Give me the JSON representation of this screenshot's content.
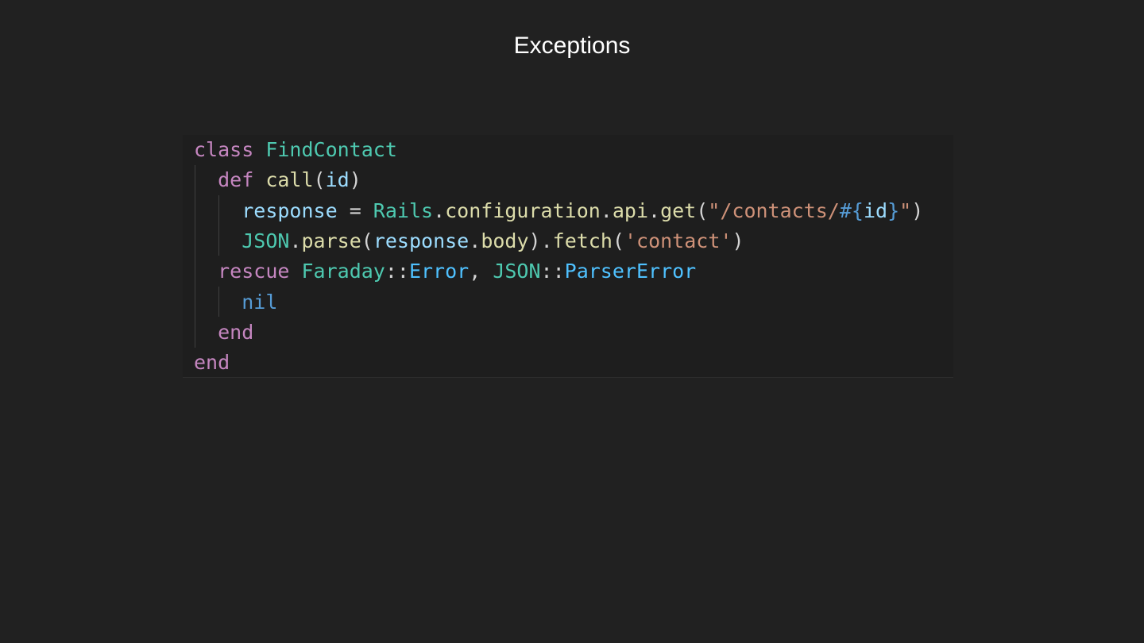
{
  "slide": {
    "title": "Exceptions"
  },
  "code": {
    "language": "ruby",
    "lines": [
      [
        {
          "text": "class",
          "role": "keyword"
        },
        {
          "text": " ",
          "role": "plain"
        },
        {
          "text": "FindContact",
          "role": "class"
        }
      ],
      [
        {
          "text": "  ",
          "role": "plain"
        },
        {
          "text": "def",
          "role": "keyword"
        },
        {
          "text": " ",
          "role": "plain"
        },
        {
          "text": "call",
          "role": "function"
        },
        {
          "text": "(",
          "role": "plain"
        },
        {
          "text": "id",
          "role": "variable"
        },
        {
          "text": ")",
          "role": "plain"
        }
      ],
      [
        {
          "text": "    ",
          "role": "plain"
        },
        {
          "text": "response",
          "role": "variable"
        },
        {
          "text": " = ",
          "role": "plain"
        },
        {
          "text": "Rails",
          "role": "class"
        },
        {
          "text": ".",
          "role": "plain"
        },
        {
          "text": "configuration",
          "role": "function"
        },
        {
          "text": ".",
          "role": "plain"
        },
        {
          "text": "api",
          "role": "function"
        },
        {
          "text": ".",
          "role": "plain"
        },
        {
          "text": "get",
          "role": "function"
        },
        {
          "text": "(",
          "role": "plain"
        },
        {
          "text": "\"/contacts/",
          "role": "string"
        },
        {
          "text": "#{",
          "role": "constant"
        },
        {
          "text": "id",
          "role": "variable"
        },
        {
          "text": "}",
          "role": "constant"
        },
        {
          "text": "\"",
          "role": "string"
        },
        {
          "text": ")",
          "role": "plain"
        }
      ],
      [
        {
          "text": "    ",
          "role": "plain"
        },
        {
          "text": "JSON",
          "role": "class"
        },
        {
          "text": ".",
          "role": "plain"
        },
        {
          "text": "parse",
          "role": "function"
        },
        {
          "text": "(",
          "role": "plain"
        },
        {
          "text": "response",
          "role": "variable"
        },
        {
          "text": ".",
          "role": "plain"
        },
        {
          "text": "body",
          "role": "function"
        },
        {
          "text": ").",
          "role": "plain"
        },
        {
          "text": "fetch",
          "role": "function"
        },
        {
          "text": "(",
          "role": "plain"
        },
        {
          "text": "'contact'",
          "role": "string"
        },
        {
          "text": ")",
          "role": "plain"
        }
      ],
      [
        {
          "text": "  ",
          "role": "plain"
        },
        {
          "text": "rescue",
          "role": "keyword"
        },
        {
          "text": " ",
          "role": "plain"
        },
        {
          "text": "Faraday",
          "role": "class"
        },
        {
          "text": "::",
          "role": "plain"
        },
        {
          "text": "Error",
          "role": "constant2"
        },
        {
          "text": ", ",
          "role": "plain"
        },
        {
          "text": "JSON",
          "role": "class"
        },
        {
          "text": "::",
          "role": "plain"
        },
        {
          "text": "ParserError",
          "role": "constant2"
        }
      ],
      [
        {
          "text": "    ",
          "role": "plain"
        },
        {
          "text": "nil",
          "role": "constant"
        }
      ],
      [
        {
          "text": "  ",
          "role": "plain"
        },
        {
          "text": "end",
          "role": "keyword"
        }
      ],
      [
        {
          "text": "end",
          "role": "keyword"
        }
      ]
    ]
  },
  "colors": {
    "background": "#212121",
    "code_background": "#1e1e1e",
    "keyword": "#c586c0",
    "class": "#4ec9b0",
    "function": "#dcdcaa",
    "variable": "#9cdcfe",
    "string": "#ce9178",
    "constant": "#569cd6",
    "constant2": "#4fc1ff",
    "plain": "#d4d4d4"
  }
}
